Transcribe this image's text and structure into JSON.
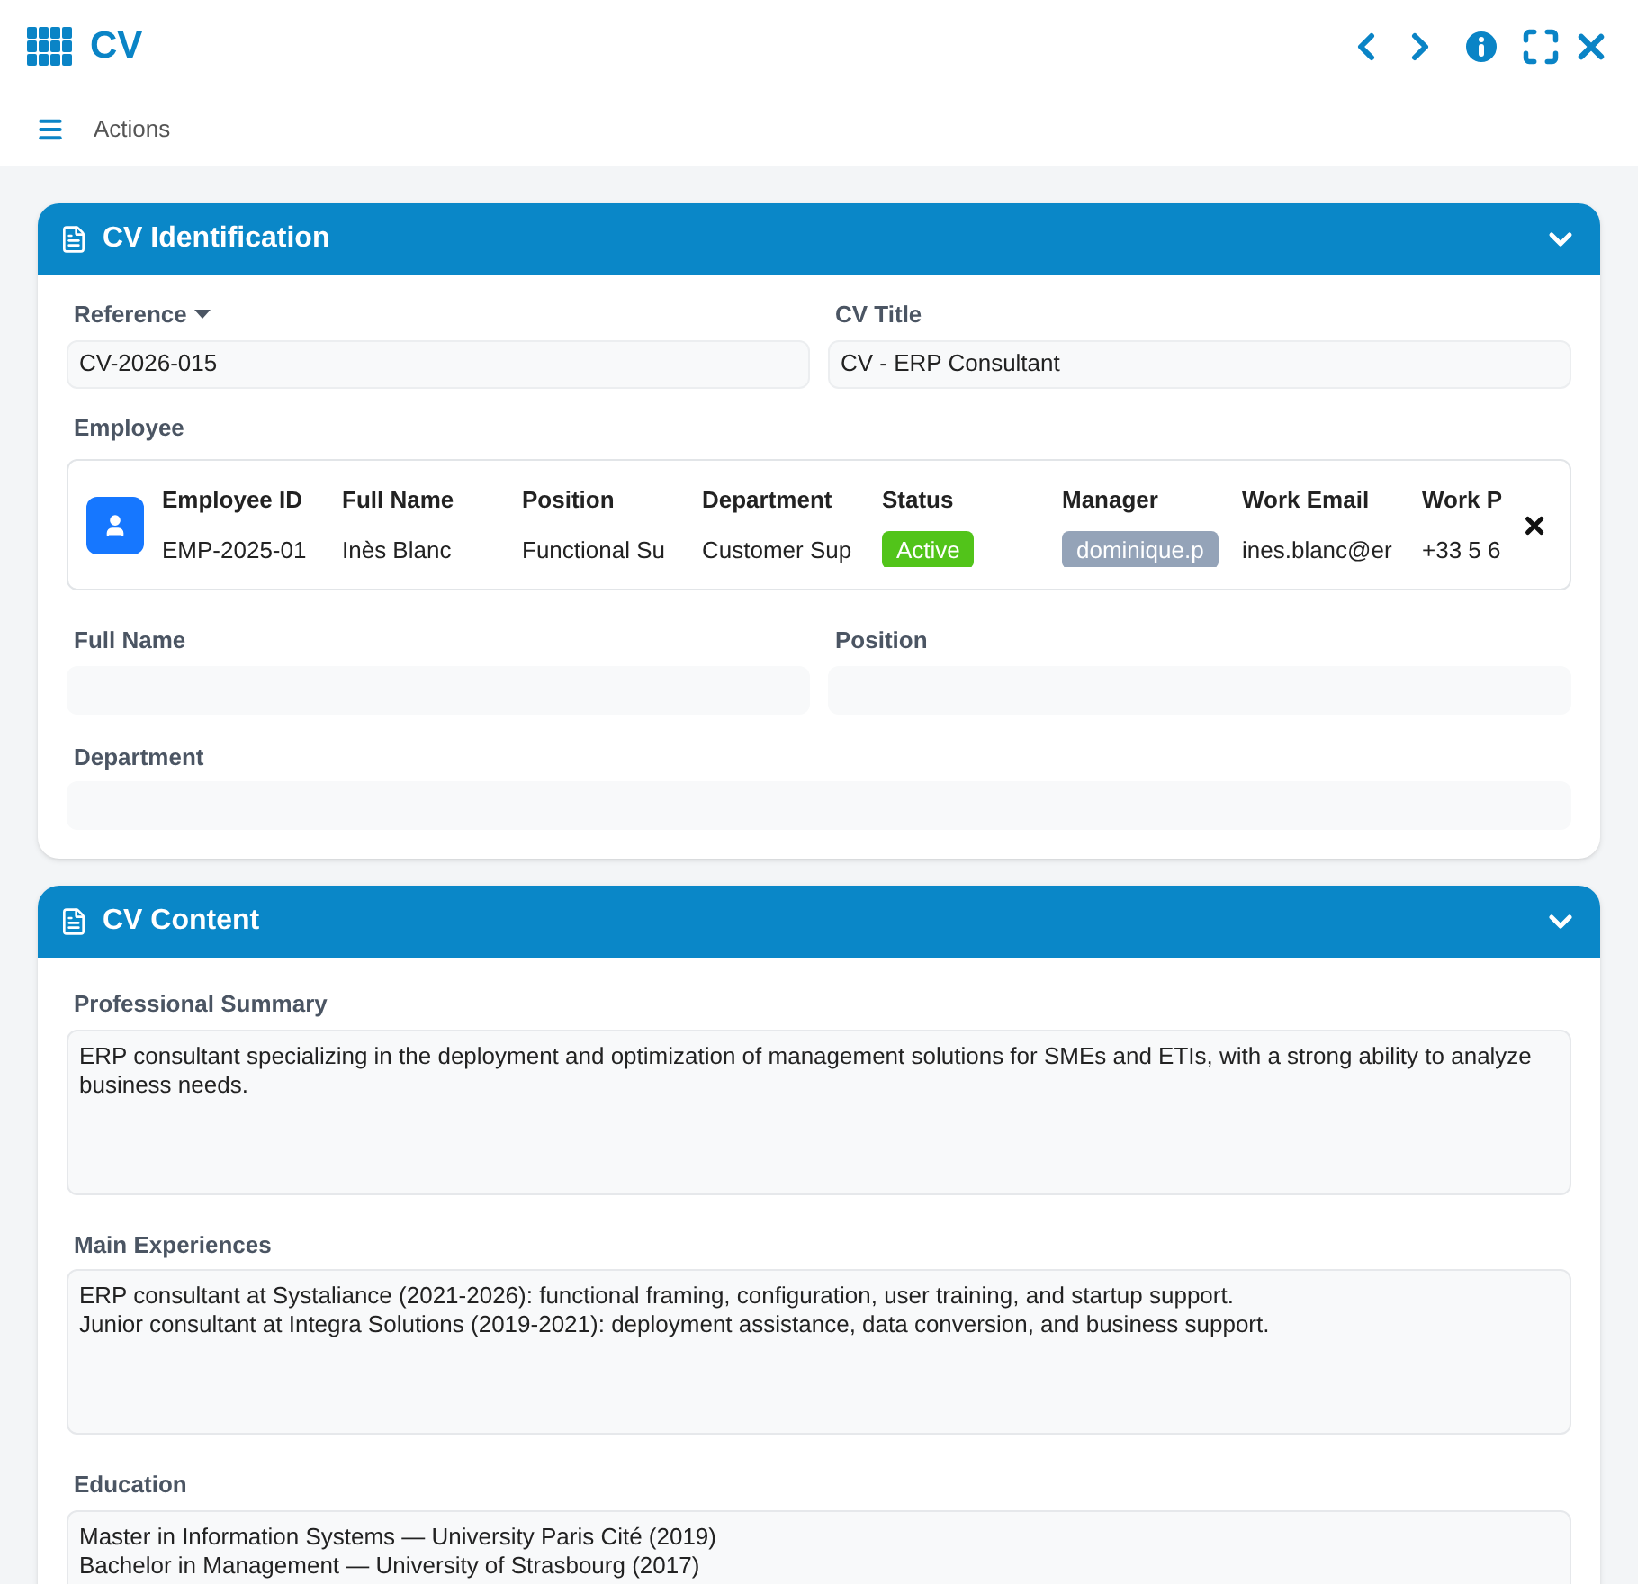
{
  "window": {
    "title": "CV"
  },
  "toolbar": {
    "actions_label": "Actions"
  },
  "sections": [
    {
      "title": "CV Identification",
      "expanded": true,
      "kind": "identification",
      "reference": {
        "label": "Reference",
        "value": "CV-2026-015"
      },
      "cv_title": {
        "label": "CV Title",
        "value": "CV - ERP Consultant"
      },
      "employee": {
        "label": "Employee",
        "columns": [
          {
            "header": "Employee ID",
            "value": "EMP-2025-01",
            "kind": "text"
          },
          {
            "header": "Full Name",
            "value": "Inès Blanc",
            "kind": "text"
          },
          {
            "header": "Position",
            "value": "Functional Su",
            "kind": "text"
          },
          {
            "header": "Department",
            "value": "Customer Sup",
            "kind": "text"
          },
          {
            "header": "Status",
            "value": "Active",
            "kind": "status"
          },
          {
            "header": "Manager",
            "value": "dominique.p",
            "kind": "tag"
          },
          {
            "header": "Work Email",
            "value": "ines.blanc@er",
            "kind": "text"
          },
          {
            "header": "Work P",
            "value": "+33 5 6",
            "kind": "text"
          }
        ]
      },
      "fields": [
        {
          "label": "Full Name"
        },
        {
          "label": "Position"
        },
        {
          "label": "Department"
        }
      ]
    },
    {
      "title": "CV Content",
      "expanded": true,
      "kind": "content",
      "areas": [
        {
          "label": "Professional Summary",
          "lines": [
            "ERP consultant specializing in the deployment and optimization of management solutions for SMEs and ETIs, with a strong ability to analyze business needs."
          ]
        },
        {
          "label": "Main Experiences",
          "lines": [
            "ERP consultant at Systaliance (2021-2026): functional framing, configuration, user training, and startup support.",
            "Junior consultant at Integra Solutions (2019-2021): deployment assistance, data conversion, and business support."
          ]
        },
        {
          "label": "Education",
          "lines": [
            "Master in Information Systems — University Paris Cité (2019)",
            "Bachelor in Management — University of Strasbourg (2017)"
          ]
        }
      ]
    }
  ]
}
